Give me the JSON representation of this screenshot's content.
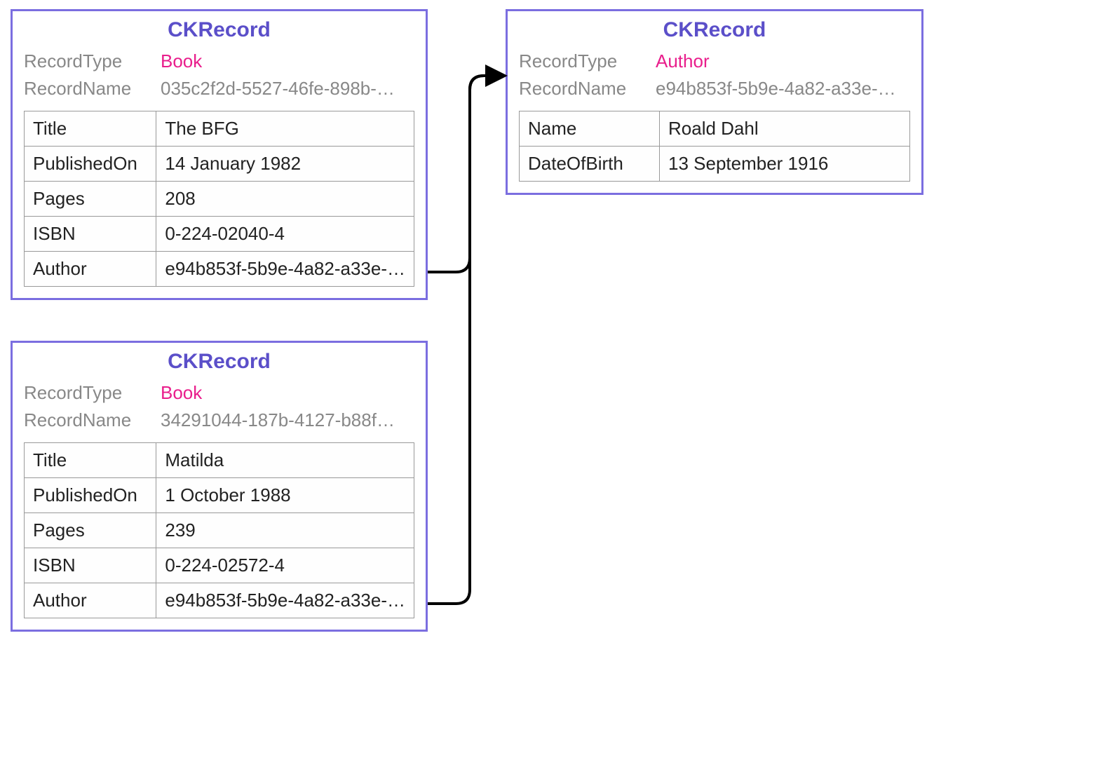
{
  "common": {
    "cardTitle": "CKRecord",
    "labelRecordType": "RecordType",
    "labelRecordName": "RecordName"
  },
  "cards": {
    "book1": {
      "recordType": "Book",
      "recordName": "035c2f2d-5527-46fe-898b-…",
      "fields": [
        {
          "key": "Title",
          "value": "The BFG"
        },
        {
          "key": "PublishedOn",
          "value": "14 January 1982"
        },
        {
          "key": "Pages",
          "value": "208"
        },
        {
          "key": "ISBN",
          "value": "0-224-02040-4"
        },
        {
          "key": "Author",
          "value": "e94b853f-5b9e-4a82-a33e-…"
        }
      ]
    },
    "book2": {
      "recordType": "Book",
      "recordName": "34291044-187b-4127-b88f…",
      "fields": [
        {
          "key": "Title",
          "value": "Matilda"
        },
        {
          "key": "PublishedOn",
          "value": "1 October 1988"
        },
        {
          "key": "Pages",
          "value": "239"
        },
        {
          "key": "ISBN",
          "value": "0-224-02572-4"
        },
        {
          "key": "Author",
          "value": "e94b853f-5b9e-4a82-a33e-…"
        }
      ]
    },
    "author": {
      "recordType": "Author",
      "recordName": "e94b853f-5b9e-4a82-a33e-…",
      "fields": [
        {
          "key": "Name",
          "value": "Roald Dahl"
        },
        {
          "key": "DateOfBirth",
          "value": "13 September 1916"
        }
      ]
    }
  }
}
